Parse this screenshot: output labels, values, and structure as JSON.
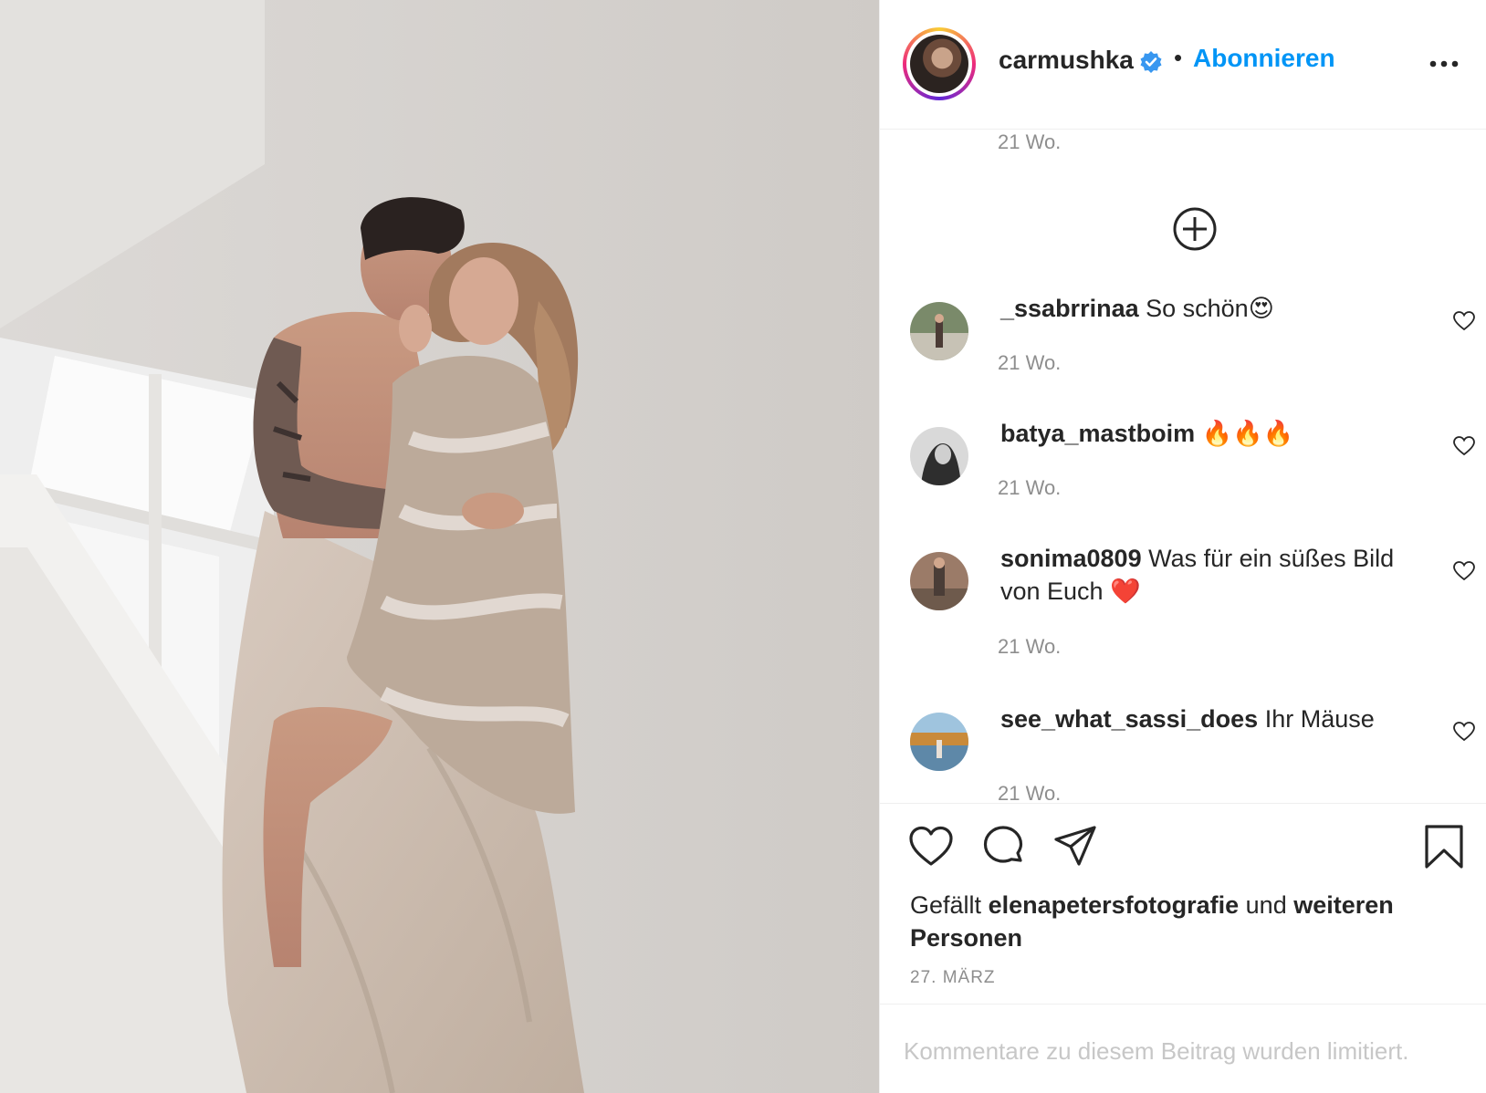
{
  "photo": {
    "description_icon": "post-photo"
  },
  "header": {
    "username": "carmushka",
    "verified_icon": "verified-badge-icon",
    "separator": "•",
    "follow_label": "Abonnieren",
    "more_icon": "more-options-icon"
  },
  "comments": {
    "top_timestamp": "21 Wo.",
    "load_more_icon": "plus-circle-icon",
    "items": [
      {
        "username": "_ssabrrinaa",
        "text": "So schön😍",
        "timestamp": "21 Wo."
      },
      {
        "username": "batya_mastboim",
        "text": "🔥🔥🔥",
        "timestamp": "21 Wo."
      },
      {
        "username": "sonima0809",
        "text": "Was für ein süßes Bild von Euch ❤️",
        "timestamp": "21 Wo."
      },
      {
        "username": "see_what_sassi_does",
        "text": "Ihr Mäuse",
        "timestamp": "21 Wo."
      }
    ]
  },
  "actions": {
    "like_icon": "heart-icon",
    "comment_icon": "comment-icon",
    "share_icon": "share-icon",
    "save_icon": "bookmark-icon",
    "likes_prefix": "Gefällt",
    "likes_user": "elenapetersfotografie",
    "likes_and": "und",
    "likes_others": "weiteren Personen",
    "date": "27. MÄRZ"
  },
  "footer": {
    "limited_text": "Kommentare zu diesem Beitrag wurden limitiert."
  },
  "colors": {
    "accent": "#0095f6",
    "text": "#262626",
    "muted": "#8e8e8e",
    "placeholder": "#c7c7c7",
    "border": "#efefef"
  }
}
